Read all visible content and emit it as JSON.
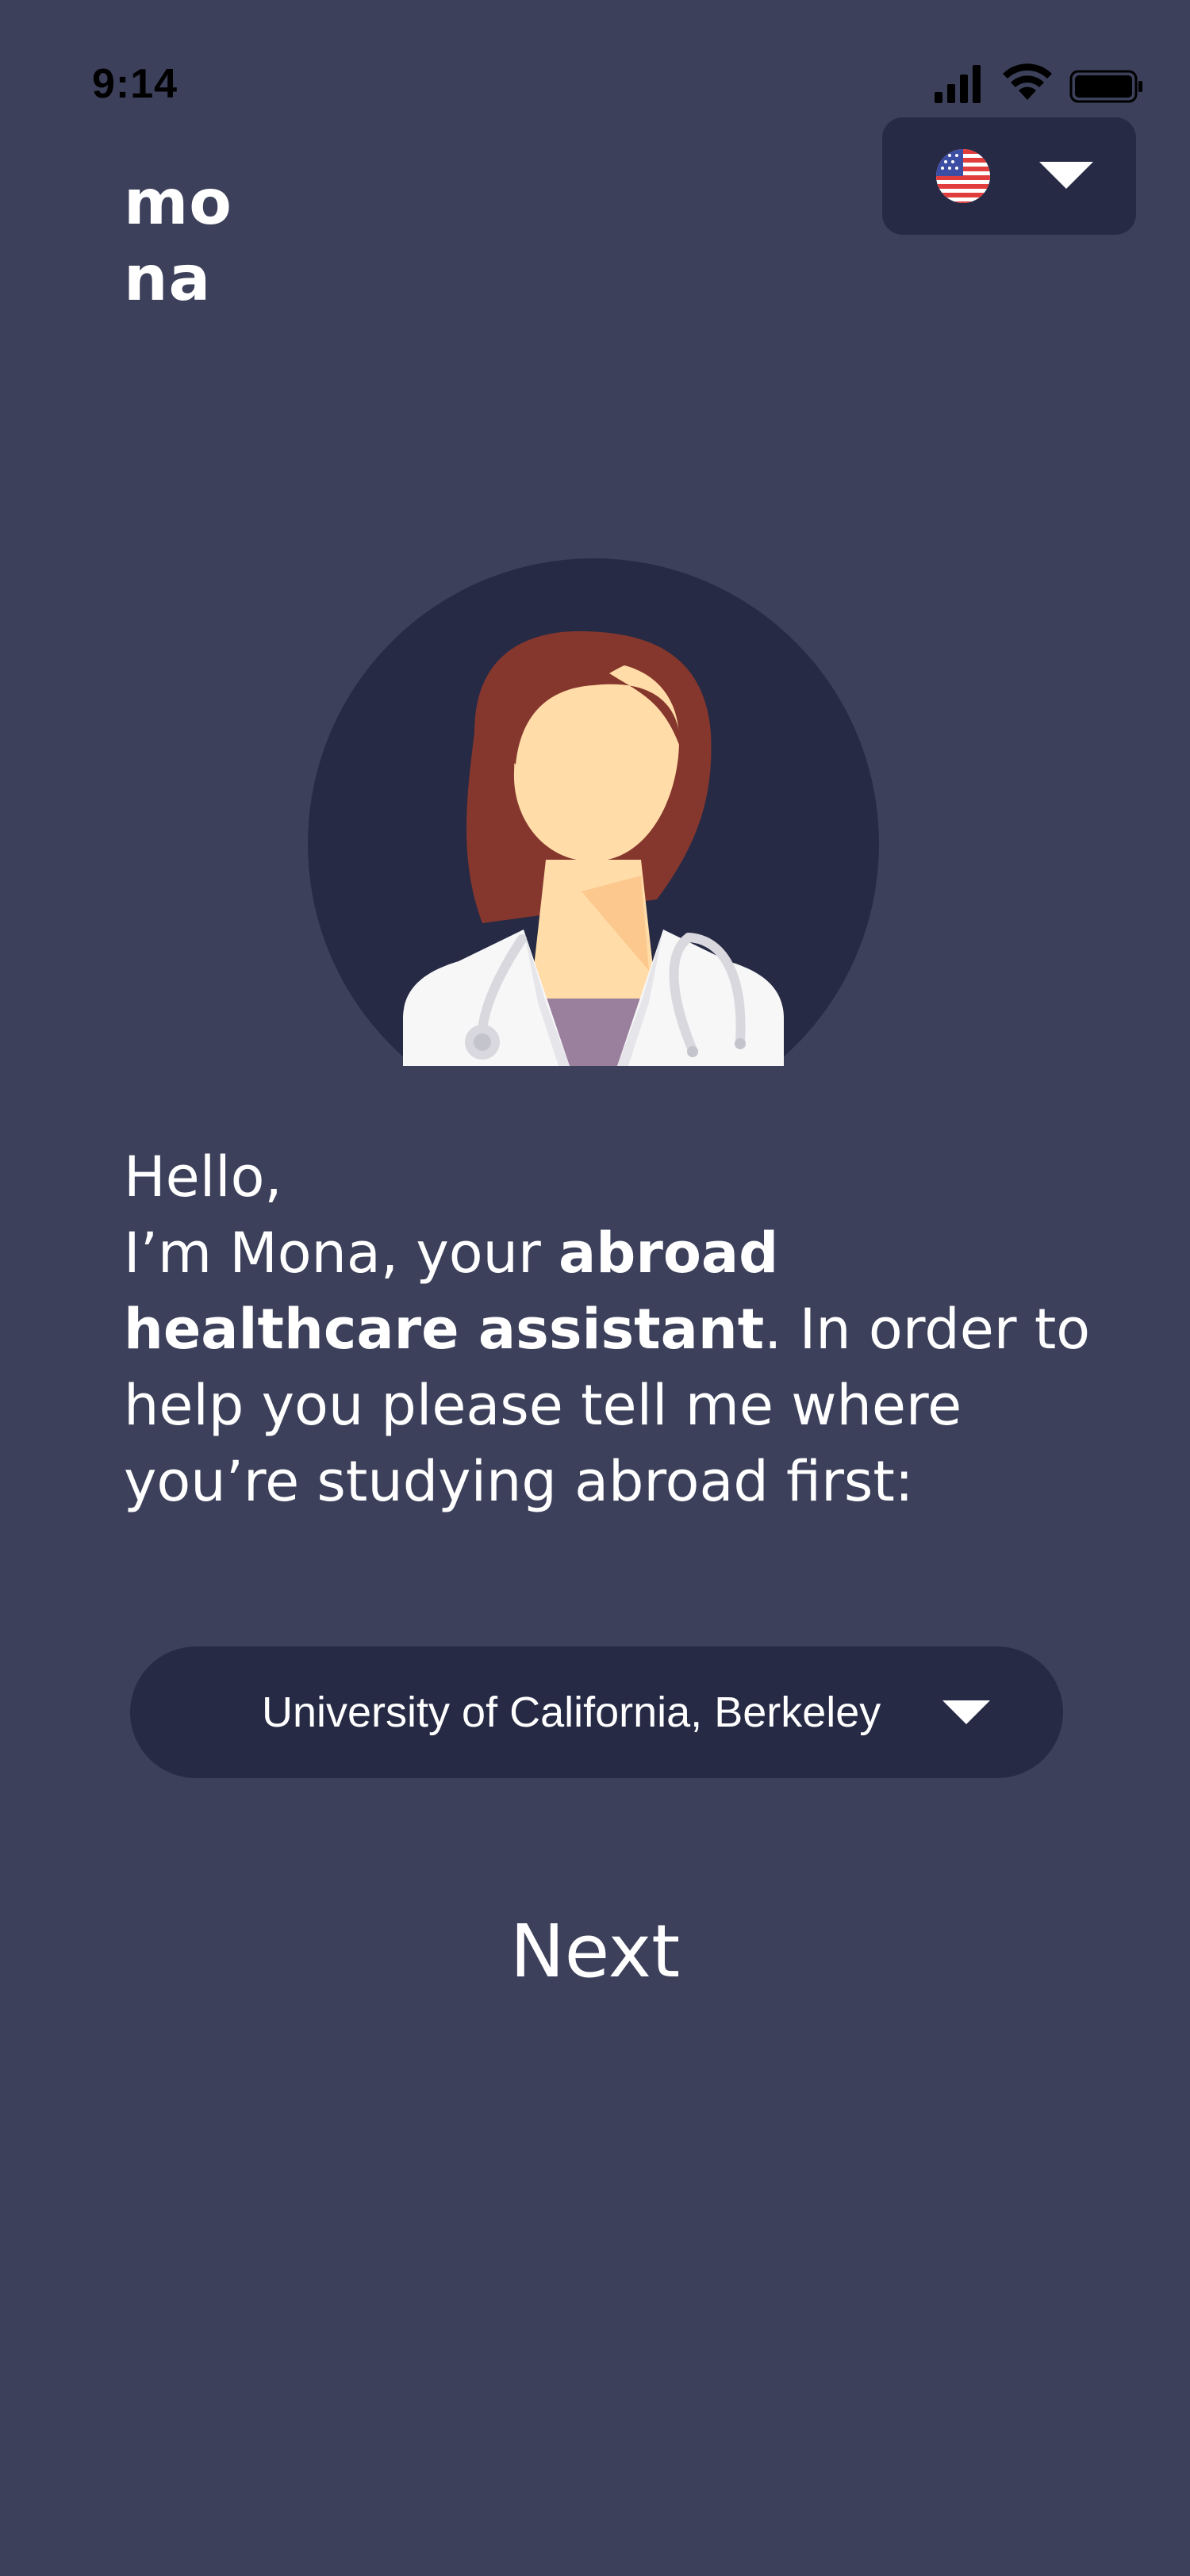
{
  "status_bar": {
    "time": "9:14",
    "icons": [
      "signal-icon",
      "wifi-icon",
      "battery-icon"
    ]
  },
  "logo": {
    "line1": "mo",
    "line2": "na"
  },
  "language_selector": {
    "flag": "us-flag-icon",
    "chevron": "chevron-down-icon"
  },
  "avatar": {
    "icon": "doctor-avatar-icon"
  },
  "intro": {
    "greeting": "Hello,",
    "part1": "I’m Mona, your ",
    "bold": "abroad healthcare assistant",
    "part2": ". In order to help you please tell me where you’re studying abroad first:"
  },
  "university_select": {
    "selected": "University of California, Berkeley",
    "chevron": "chevron-down-icon"
  },
  "next_button": {
    "label": "Next"
  },
  "colors": {
    "background": "#3c405a",
    "control_background": "#262a44",
    "avatar_circle": "#262a44",
    "hair": "#86372d",
    "skin": "#ffdca8",
    "coat": "#f7f7f8",
    "shirt": "#9b809e",
    "text": "#ffffff"
  }
}
